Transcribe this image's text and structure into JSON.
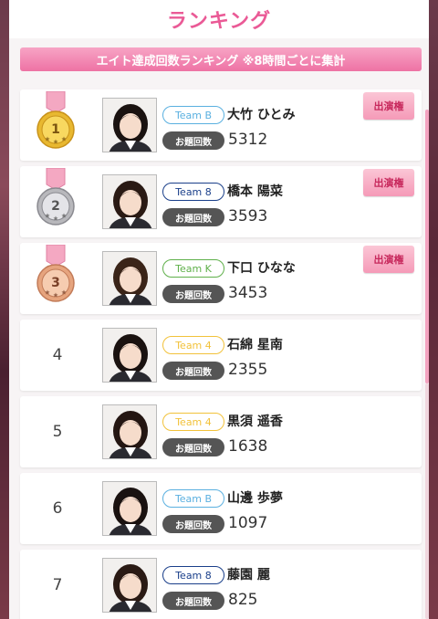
{
  "page": {
    "title": "ランキング",
    "banner": "エイト達成回数ランキング ※8時間ごとに集計"
  },
  "labels": {
    "count_label": "お題回数",
    "performance_badge": "出演権"
  },
  "colors": {
    "title_pink": "#ea5a96",
    "Team B": "#5ab0e0",
    "Team 8": "#1a3f8a",
    "Team K": "#5fb04a",
    "Team 4": "#f2c23a"
  },
  "rankings": [
    {
      "rank": "1",
      "medal": "gold",
      "team": "Team B",
      "name": "大竹 ひとみ",
      "count": "5312",
      "performance": true
    },
    {
      "rank": "2",
      "medal": "silver",
      "team": "Team 8",
      "name": "橋本 陽菜",
      "count": "3593",
      "performance": true
    },
    {
      "rank": "3",
      "medal": "bronze",
      "team": "Team K",
      "name": "下口 ひなな",
      "count": "3453",
      "performance": true
    },
    {
      "rank": "4",
      "medal": null,
      "team": "Team 4",
      "name": "石綿 星南",
      "count": "2355",
      "performance": false
    },
    {
      "rank": "5",
      "medal": null,
      "team": "Team 4",
      "name": "黒須 遥香",
      "count": "1638",
      "performance": false
    },
    {
      "rank": "6",
      "medal": null,
      "team": "Team B",
      "name": "山邊 歩夢",
      "count": "1097",
      "performance": false
    },
    {
      "rank": "7",
      "medal": null,
      "team": "Team 8",
      "name": "藤園 麗",
      "count": "825",
      "performance": false
    }
  ]
}
